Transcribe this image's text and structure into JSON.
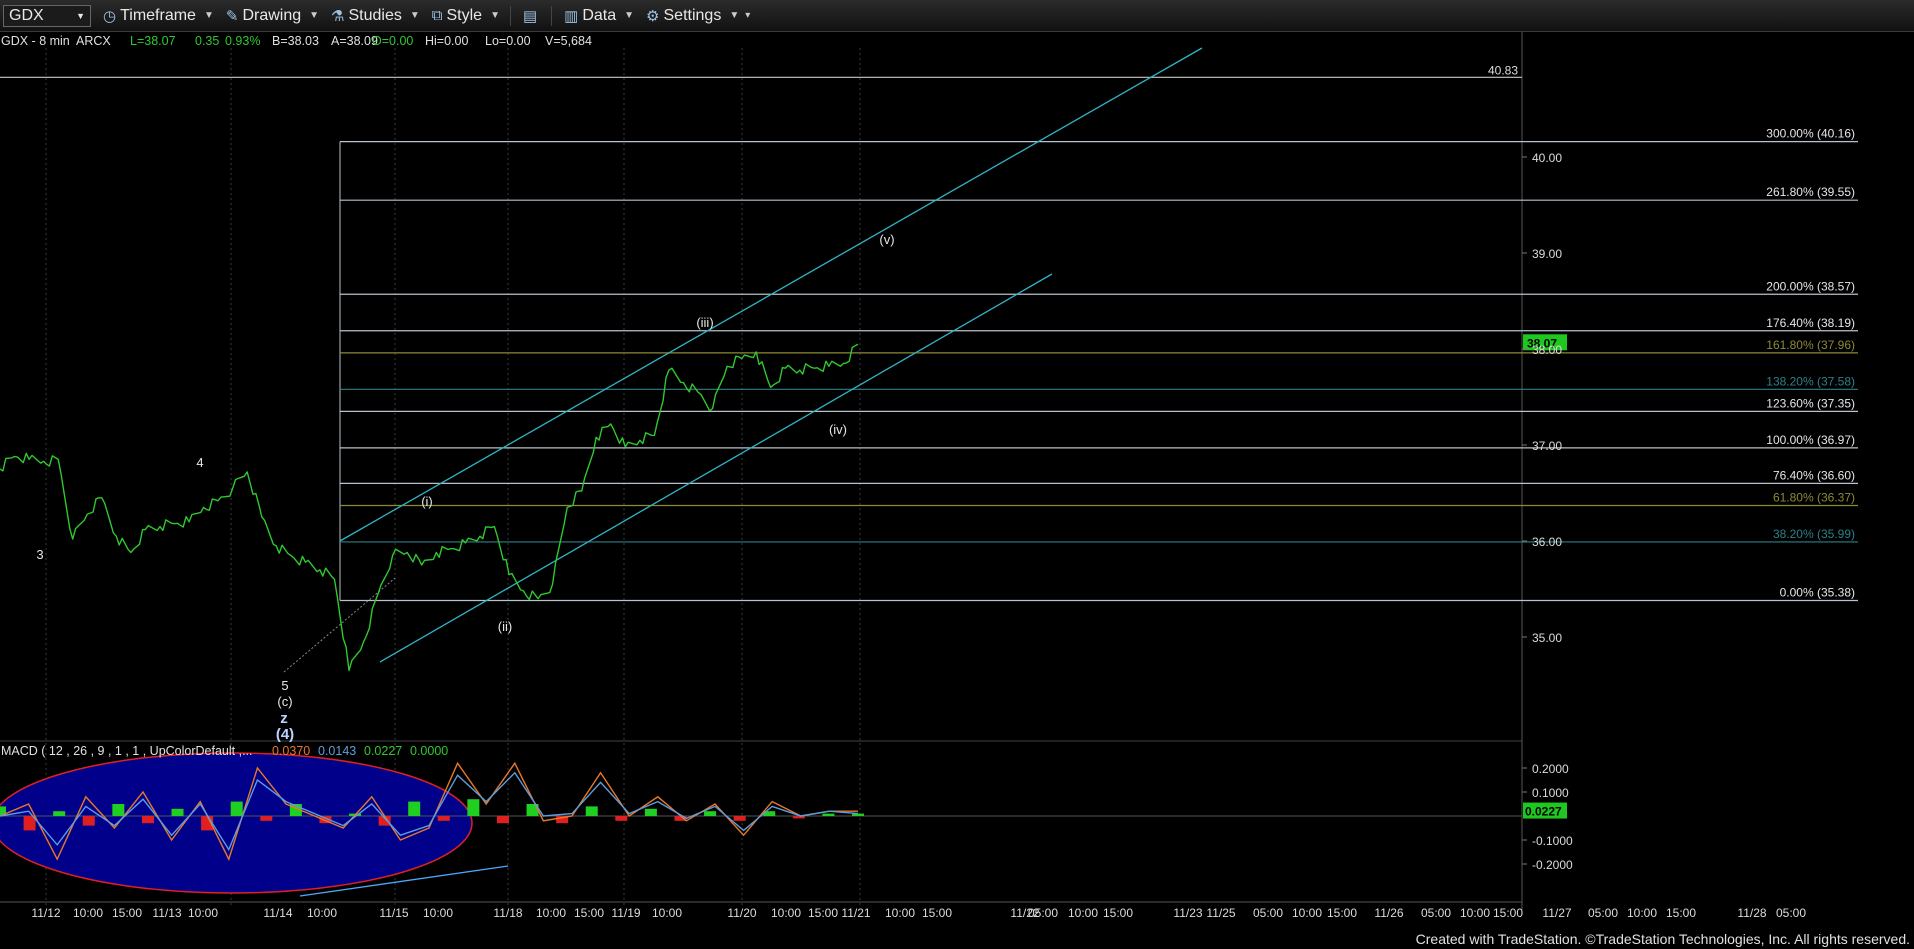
{
  "toolbar": {
    "symbol": "GDX",
    "items": [
      {
        "label": "Timeframe",
        "icon": "clock-icon"
      },
      {
        "label": "Drawing",
        "icon": "pencil-icon"
      },
      {
        "label": "Studies",
        "icon": "flask-icon"
      },
      {
        "label": "Style",
        "icon": "style-icon"
      },
      {
        "label": "",
        "icon": "layout-icon"
      },
      {
        "label": "Data",
        "icon": "bar-chart-icon"
      },
      {
        "label": "Settings",
        "icon": "gear-icon"
      }
    ]
  },
  "header": {
    "symbol_desc": "GDX - 8 min  ARCX",
    "last": "L=38.07",
    "change": "0.35",
    "change_pct": "0.93%",
    "bid": "B=38.03",
    "ask": "A=38.09",
    "open": "O=0.00",
    "high": "Hi=0.00",
    "low": "Lo=0.00",
    "volume": "V=5,684"
  },
  "footer": "Created with TradeStation. ©TradeStation Technologies, Inc. All rights reserved.",
  "colors": {
    "price": "#2fc82f",
    "channel": "#2fb5c8",
    "fib_white": "#b8c2cc",
    "fib_gold": "#8c8a34",
    "fib_teal": "#2e7f8a",
    "macd_fast": "#e8782a",
    "macd_slow": "#5c9de0",
    "hist_up": "#20d020",
    "hist_down": "#e02020",
    "ellipse_fill": "#00008b",
    "ellipse_stroke": "#e02020",
    "last_badge": "#1ec81e"
  },
  "chart_data": [
    {
      "type": "line",
      "title": "GDX - 8 min",
      "ylim": [
        34.0,
        41.0
      ],
      "y_ticks": [
        "40.83",
        "40.00",
        "39.00",
        "38.00",
        "37.00",
        "36.00",
        "35.00"
      ],
      "last_price": "38.07",
      "x_ticks": [
        "11/12",
        "10:00",
        "15:00",
        "11/13",
        "10:00",
        "11/14",
        "10:00",
        "11/15",
        "10:00",
        "11/18",
        "10:00",
        "15:00",
        "11/19",
        "10:00",
        "11/20",
        "10:00",
        "15:00",
        "11/21",
        "10:00",
        "15:00",
        "11/22",
        "05:00",
        "10:00",
        "15:00",
        "11/23",
        "11/25",
        "05:00",
        "10:00",
        "15:00",
        "11/26",
        "05:00",
        "10:00",
        "15:00",
        "11/27",
        "05:00",
        "10:00",
        "15:00",
        "11/28",
        "05:00"
      ],
      "series": [
        {
          "values": [
            36.75,
            36.88,
            36.85,
            36.83,
            36.85,
            36.02,
            36.28,
            36.45,
            36.05,
            35.88,
            36.12,
            36.15,
            36.18,
            36.2,
            36.35,
            36.42,
            36.55,
            36.72,
            36.25,
            35.95,
            35.85,
            35.78,
            35.7,
            35.6,
            34.65,
            34.95,
            35.45,
            35.85,
            35.88,
            35.75,
            35.88,
            35.92,
            35.98,
            36.05,
            36.15,
            35.65,
            35.48,
            35.4,
            35.55,
            36.35,
            36.52,
            37.08,
            37.22,
            36.98,
            37.05,
            37.1,
            37.78,
            37.65,
            37.55,
            37.38,
            37.82,
            37.9,
            37.97,
            37.6,
            37.8,
            37.78,
            37.8,
            37.82,
            37.85,
            38.05
          ]
        }
      ],
      "fib_levels": [
        {
          "label": "300.00% (40.16)",
          "value": 40.16,
          "style": "white"
        },
        {
          "label": "261.80% (39.55)",
          "value": 39.55,
          "style": "white"
        },
        {
          "label": "200.00% (38.57)",
          "value": 38.57,
          "style": "white"
        },
        {
          "label": "176.40% (38.19)",
          "value": 38.19,
          "style": "white"
        },
        {
          "label": "161.80% (37.96)",
          "value": 37.96,
          "style": "gold"
        },
        {
          "label": "138.20% (37.58)",
          "value": 37.58,
          "style": "teal"
        },
        {
          "label": "123.60% (37.35)",
          "value": 37.35,
          "style": "white"
        },
        {
          "label": "100.00% (36.97)",
          "value": 36.97,
          "style": "white"
        },
        {
          "label": "76.40% (36.60)",
          "value": 36.6,
          "style": "white"
        },
        {
          "label": "61.80% (36.37)",
          "value": 36.37,
          "style": "gold"
        },
        {
          "label": "38.20% (35.99)",
          "value": 35.99,
          "style": "teal"
        },
        {
          "label": "0.00% (35.38)",
          "value": 35.38,
          "style": "white"
        }
      ],
      "top_level": {
        "label": "40.83",
        "value": 40.83
      },
      "wave_labels": [
        "3",
        "4",
        "5",
        "(c)",
        "z",
        "(4)",
        "(i)",
        "(ii)",
        "(iii)",
        "(iv)",
        "(v)"
      ]
    },
    {
      "type": "line",
      "title": "MACD ( 12 , 26 , 9 , 1 , 1 , UpColorDefault ,...",
      "readouts": [
        "0.0370",
        "0.0143",
        "0.0227",
        "0.0000"
      ],
      "ylim": [
        -0.25,
        0.25
      ],
      "y_ticks": [
        "0.2000",
        "0.1000",
        "-0.1000",
        "-0.2000"
      ],
      "last_value": "0.0227",
      "series": [
        {
          "name": "MACD",
          "values": [
            0.0,
            0.05,
            -0.18,
            0.08,
            -0.05,
            0.1,
            -0.1,
            0.06,
            -0.18,
            0.2,
            0.05,
            0.0,
            -0.05,
            0.08,
            -0.1,
            -0.05,
            0.22,
            0.05,
            0.22,
            -0.02,
            0.0,
            0.18,
            0.0,
            0.08,
            -0.02,
            0.05,
            -0.08,
            0.06,
            0.0,
            0.02,
            0.02
          ]
        },
        {
          "name": "Signal",
          "values": [
            0.0,
            0.02,
            -0.12,
            0.04,
            -0.04,
            0.07,
            -0.08,
            0.05,
            -0.14,
            0.15,
            0.06,
            0.01,
            -0.04,
            0.05,
            -0.08,
            -0.04,
            0.17,
            0.06,
            0.18,
            0.0,
            0.01,
            0.14,
            0.01,
            0.06,
            -0.01,
            0.04,
            -0.06,
            0.04,
            0.0,
            0.02,
            0.01
          ]
        }
      ],
      "hist": [
        0.04,
        -0.06,
        0.02,
        -0.04,
        0.05,
        -0.03,
        0.03,
        -0.06,
        0.06,
        -0.02,
        0.05,
        -0.03,
        0.01,
        -0.04,
        0.06,
        -0.02,
        0.07,
        -0.03,
        0.05,
        -0.03,
        0.04,
        -0.02,
        0.03,
        -0.02,
        0.02,
        -0.02,
        0.02,
        -0.01,
        0.01,
        0.01
      ]
    }
  ]
}
